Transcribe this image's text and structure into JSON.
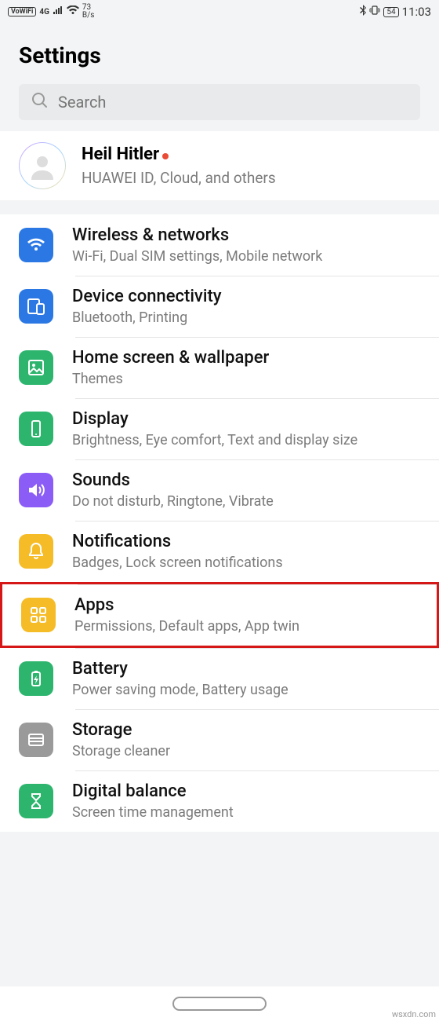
{
  "status_bar": {
    "vowifi": "VoWiFi",
    "net_type": "4G",
    "speed_num": "73",
    "speed_unit": "B/s",
    "battery": "54",
    "time": "11:03"
  },
  "page_title": "Settings",
  "search": {
    "placeholder": "Search"
  },
  "account": {
    "name": "Heil Hitler",
    "sub": "HUAWEI ID, Cloud, and others"
  },
  "items": [
    {
      "id": "wireless",
      "title": "Wireless & networks",
      "sub": "Wi-Fi, Dual SIM settings, Mobile network",
      "color": "ic-blue",
      "icon": "wifi"
    },
    {
      "id": "device",
      "title": "Device connectivity",
      "sub": "Bluetooth, Printing",
      "color": "ic-blue",
      "icon": "device"
    },
    {
      "id": "home",
      "title": "Home screen & wallpaper",
      "sub": "Themes",
      "color": "ic-green",
      "icon": "image"
    },
    {
      "id": "display",
      "title": "Display",
      "sub": "Brightness, Eye comfort, Text and display size",
      "color": "ic-green",
      "icon": "display"
    },
    {
      "id": "sounds",
      "title": "Sounds",
      "sub": "Do not disturb, Ringtone, Vibrate",
      "color": "ic-purple",
      "icon": "sound"
    },
    {
      "id": "notifications",
      "title": "Notifications",
      "sub": "Badges, Lock screen notifications",
      "color": "ic-yellow",
      "icon": "bell"
    },
    {
      "id": "apps",
      "title": "Apps",
      "sub": "Permissions, Default apps, App twin",
      "color": "ic-yellow",
      "icon": "apps",
      "highlight": true
    },
    {
      "id": "battery",
      "title": "Battery",
      "sub": "Power saving mode, Battery usage",
      "color": "ic-green",
      "icon": "battery"
    },
    {
      "id": "storage",
      "title": "Storage",
      "sub": "Storage cleaner",
      "color": "ic-grey",
      "icon": "storage"
    },
    {
      "id": "digital",
      "title": "Digital balance",
      "sub": "Screen time management",
      "color": "ic-green",
      "icon": "hourglass"
    }
  ],
  "watermark": "wsxdn.com"
}
